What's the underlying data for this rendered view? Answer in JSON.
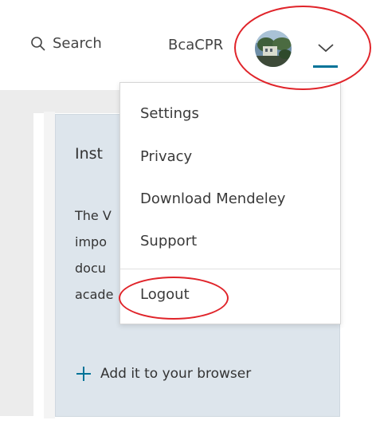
{
  "header": {
    "search_label": "Search",
    "username": "BcaCPR"
  },
  "menu": {
    "items": [
      {
        "label": "Settings"
      },
      {
        "label": "Privacy"
      },
      {
        "label": "Download Mendeley"
      },
      {
        "label": "Support"
      },
      {
        "label": "Logout"
      }
    ]
  },
  "panel": {
    "title": "Inst",
    "lines": [
      "The V",
      "impo",
      "docu",
      "acade"
    ],
    "add_label": "Add it to your browser"
  },
  "colors": {
    "accent": "#007398",
    "annotation": "#e0242a",
    "panel_background": "#dde5ec"
  },
  "icons": {
    "search": "search-icon",
    "chevron": "chevron-down-icon",
    "plus": "plus-icon"
  }
}
